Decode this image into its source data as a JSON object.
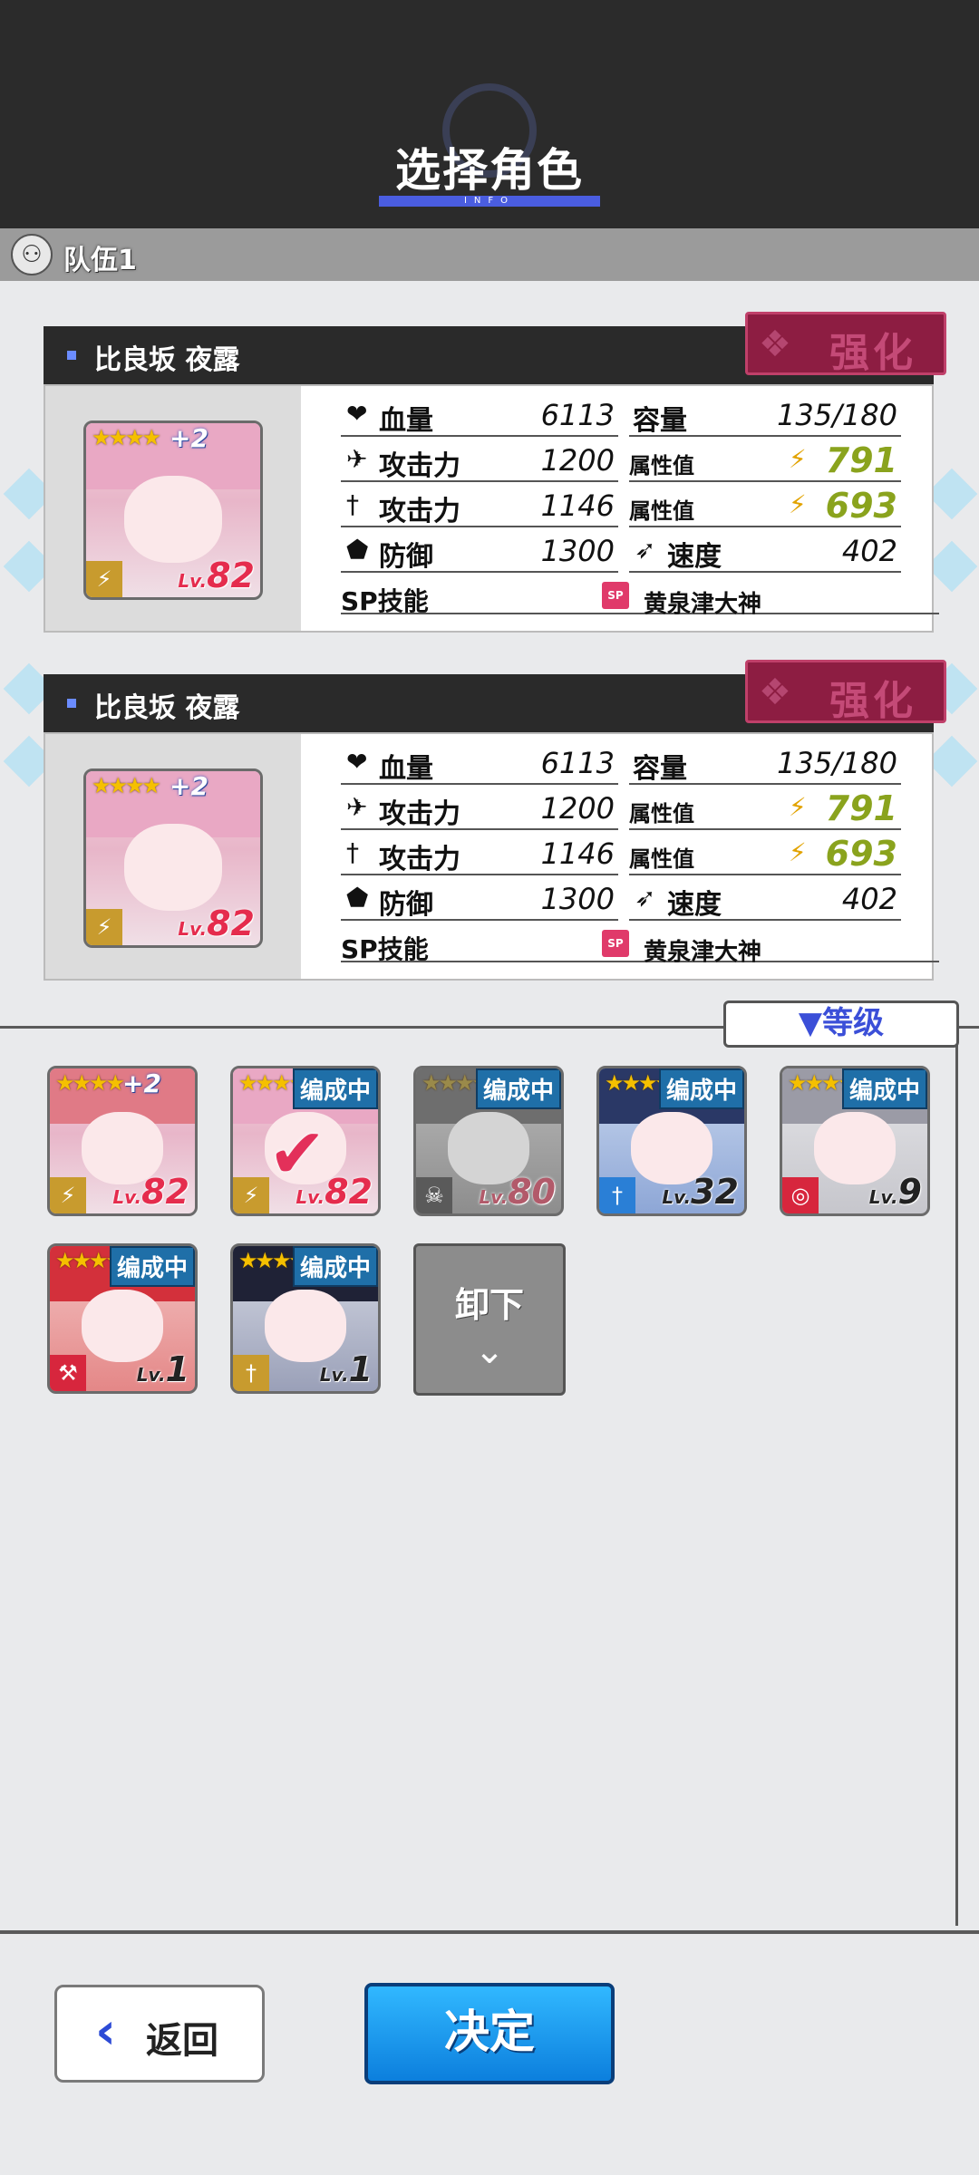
{
  "header": {
    "title": "选择角色",
    "subtitle": "INFO"
  },
  "team": {
    "label": "队伍1"
  },
  "cards": [
    {
      "name": "比良坂 夜露",
      "enhance_label": "强化",
      "portrait": {
        "stars": "★★★★",
        "plus": "+2",
        "level": "82",
        "lv_prefix": "Lv."
      },
      "stats": {
        "hp_label": "血量",
        "hp": "6113",
        "cap_label": "容量",
        "cap": "135/180",
        "atk1_label": "攻击力",
        "atk1": "1200",
        "attr1_label": "属性值",
        "attr1": "791",
        "atk2_label": "攻击力",
        "atk2": "1146",
        "attr2_label": "属性值",
        "attr2": "693",
        "def_label": "防御",
        "def": "1300",
        "spd_label": "速度",
        "spd": "402"
      },
      "sp_label": "SP技能",
      "sp_badge": "SP",
      "sp_name": "黄泉津大神"
    },
    {
      "name": "比良坂 夜露",
      "enhance_label": "强化",
      "portrait": {
        "stars": "★★★★",
        "plus": "+2",
        "level": "82",
        "lv_prefix": "Lv."
      },
      "stats": {
        "hp_label": "血量",
        "hp": "6113",
        "cap_label": "容量",
        "cap": "135/180",
        "atk1_label": "攻击力",
        "atk1": "1200",
        "attr1_label": "属性值",
        "attr1": "791",
        "atk2_label": "攻击力",
        "atk2": "1146",
        "attr2_label": "属性值",
        "attr2": "693",
        "def_label": "防御",
        "def": "1300",
        "spd_label": "速度",
        "spd": "402"
      },
      "sp_label": "SP技能",
      "sp_badge": "SP",
      "sp_name": "黄泉津大神"
    }
  ],
  "sort": {
    "label": "▼等级"
  },
  "roster": [
    {
      "stars": "★★★★",
      "plus": "+2",
      "badge": "",
      "level": "82",
      "lv_prefix": "Lv.",
      "weapon_icon": "gun-icon",
      "state": "normal"
    },
    {
      "stars": "★★★★",
      "plus": "",
      "badge": "编成中",
      "level": "82",
      "lv_prefix": "Lv.",
      "weapon_icon": "gun-icon",
      "state": "selected"
    },
    {
      "stars": "★★★★",
      "plus": "",
      "badge": "编成中",
      "level": "80",
      "lv_prefix": "Lv.",
      "weapon_icon": "skull-icon",
      "state": "grayed"
    },
    {
      "stars": "★★★★",
      "plus": "",
      "badge": "编成中",
      "level": "32",
      "lv_prefix": "Lv.",
      "weapon_icon": "sword-icon",
      "state": "normal"
    },
    {
      "stars": "★★★★",
      "plus": "",
      "badge": "编成中",
      "level": "9",
      "lv_prefix": "Lv.",
      "weapon_icon": "target-icon",
      "state": "normal"
    },
    {
      "stars": "★★★★",
      "plus": "",
      "badge": "编成中",
      "level": "1",
      "lv_prefix": "Lv.",
      "weapon_icon": "hammer-icon",
      "state": "normal"
    },
    {
      "stars": "★★★★",
      "plus": "",
      "badge": "编成中",
      "level": "1",
      "lv_prefix": "Lv.",
      "weapon_icon": "sword-icon",
      "state": "normal"
    }
  ],
  "unequip": {
    "label": "卸下",
    "icon": "chevron-down-icon"
  },
  "buttons": {
    "back_label": "返回",
    "confirm_label": "决定"
  },
  "colors": {
    "accent": "#4a5de0",
    "enhance": "#8d1d42",
    "confirm": "#1a9bf0",
    "level": "#e52c4d",
    "attr_value": "#8aa31d"
  }
}
